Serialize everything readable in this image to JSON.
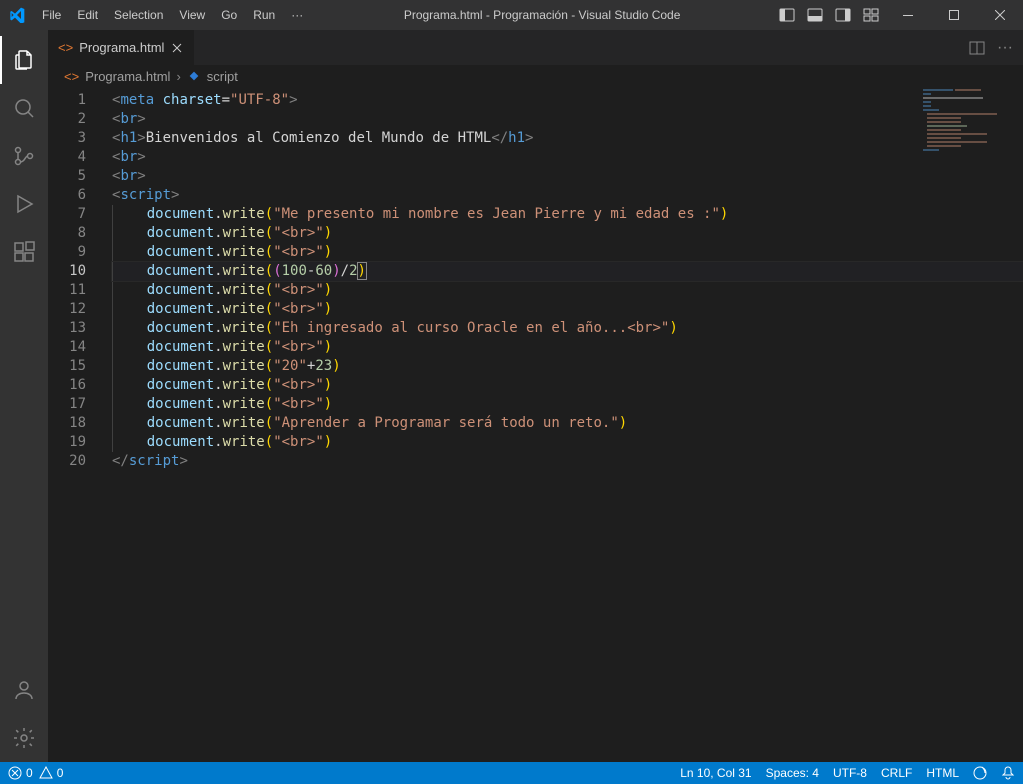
{
  "menu": {
    "file": "File",
    "edit": "Edit",
    "selection": "Selection",
    "view": "View",
    "go": "Go",
    "run": "Run",
    "more": "···"
  },
  "title": "Programa.html - Programación - Visual Studio Code",
  "tab": {
    "filename": "Programa.html"
  },
  "breadcrumb": {
    "file": "Programa.html",
    "symbol": "script"
  },
  "lines": {
    "l1": {
      "tag": "meta",
      "attr": "charset",
      "val": "\"UTF-8\""
    },
    "l2": {
      "tag": "br"
    },
    "l3": {
      "tag_open": "h1",
      "text": "Bienvenidos al Comienzo del Mundo de HTML",
      "tag_close": "h1"
    },
    "l4": {
      "tag": "br"
    },
    "l5": {
      "tag": "br"
    },
    "l6": {
      "tag": "script"
    },
    "l7": {
      "obj": "document",
      "fn": "write",
      "arg": "\"Me presento mi nombre es Jean Pierre y mi edad es :\""
    },
    "l8": {
      "obj": "document",
      "fn": "write",
      "arg": "\"<br>\""
    },
    "l9": {
      "obj": "document",
      "fn": "write",
      "arg": "\"<br>\""
    },
    "l10": {
      "obj": "document",
      "fn": "write",
      "n1": "100",
      "n2": "60",
      "n3": "2"
    },
    "l11": {
      "obj": "document",
      "fn": "write",
      "arg": "\"<br>\""
    },
    "l12": {
      "obj": "document",
      "fn": "write",
      "arg": "\"<br>\""
    },
    "l13": {
      "obj": "document",
      "fn": "write",
      "arg": "\"Eh ingresado al curso Oracle en el año...<br>\""
    },
    "l14": {
      "obj": "document",
      "fn": "write",
      "arg": "\"<br>\""
    },
    "l15": {
      "obj": "document",
      "fn": "write",
      "arg_str": "\"20\"",
      "arg_num": "23"
    },
    "l16": {
      "obj": "document",
      "fn": "write",
      "arg": "\"<br>\""
    },
    "l17": {
      "obj": "document",
      "fn": "write",
      "arg": "\"<br>\""
    },
    "l18": {
      "obj": "document",
      "fn": "write",
      "arg": "\"Aprender a Programar será todo un reto.\""
    },
    "l19": {
      "obj": "document",
      "fn": "write",
      "arg": "\"<br>\""
    },
    "l20": {
      "tag": "script"
    }
  },
  "line_numbers": [
    "1",
    "2",
    "3",
    "4",
    "5",
    "6",
    "7",
    "8",
    "9",
    "10",
    "11",
    "12",
    "13",
    "14",
    "15",
    "16",
    "17",
    "18",
    "19",
    "20"
  ],
  "status": {
    "errors": "0",
    "warnings": "0",
    "ln_col": "Ln 10, Col 31",
    "spaces": "Spaces: 4",
    "encoding": "UTF-8",
    "eol": "CRLF",
    "lang": "HTML"
  }
}
